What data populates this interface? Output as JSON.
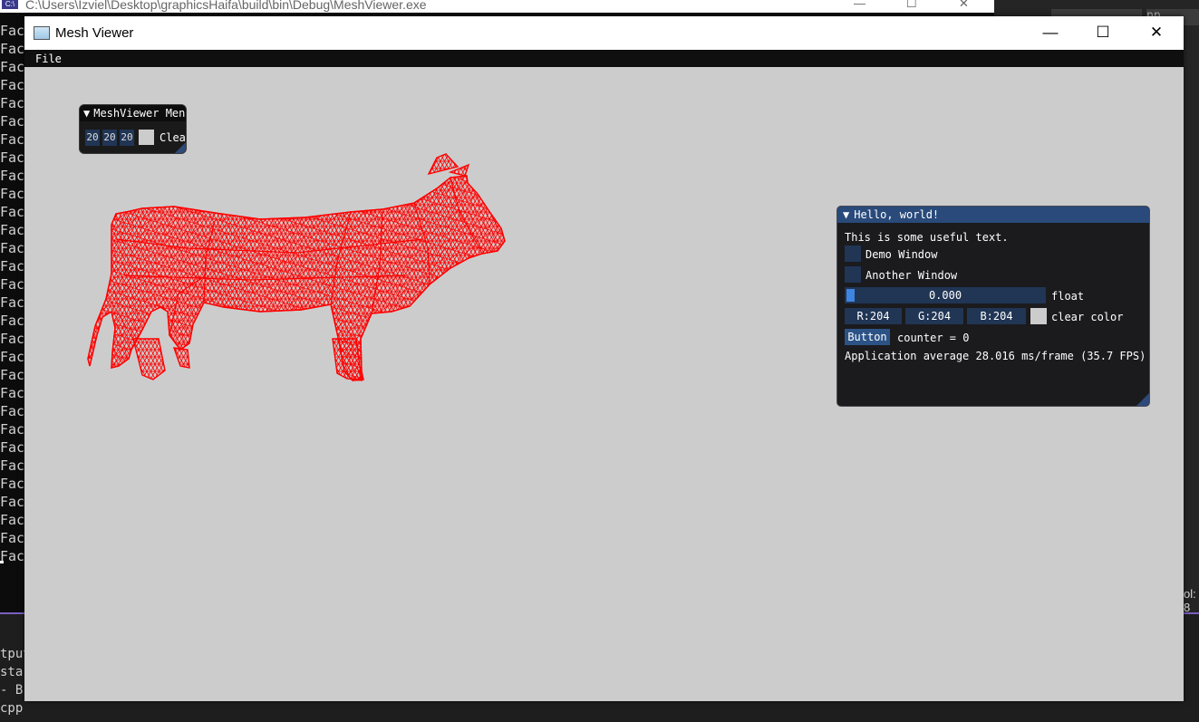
{
  "background_console": {
    "title": "C:\\Users\\Izviel\\Desktop\\graphicsHaifa\\build\\bin\\Debug\\MeshViewer.exe",
    "icon_label": "C:\\",
    "line_text": "Face",
    "line_count": 30,
    "bottom_lines": [
      "tput",
      "star",
      "- B",
      "cpp"
    ],
    "right_edge_text": "ol: 8",
    "right_tab_text": "pp"
  },
  "window": {
    "title": "Mesh Viewer",
    "menu": {
      "file_label": "File"
    },
    "controls": {
      "minimize": "—",
      "maximize": "☐",
      "close": "✕"
    }
  },
  "mesh_menu_window": {
    "title": "MeshViewer Menu",
    "collapse_glyph": "▼",
    "values": [
      "20",
      "20",
      "20"
    ],
    "clear_label": "Clear"
  },
  "hello_window": {
    "title": "Hello, world!",
    "collapse_glyph": "▼",
    "intro_text": "This is some useful text.",
    "demo_window_label": "Demo Window",
    "another_window_label": "Another Window",
    "slider": {
      "value_text": "0.000",
      "label": "float",
      "fraction": 0.0
    },
    "color": {
      "r": "R:204",
      "g": "G:204",
      "b": "B:204",
      "label": "clear color",
      "swatch": "#cccccc"
    },
    "button_label": "Button",
    "counter_text": "counter = 0",
    "stats_text": "Application average 28.016 ms/frame (35.7 FPS)"
  },
  "mesh": {
    "color": "#ff0000",
    "background": "#cccccc"
  }
}
